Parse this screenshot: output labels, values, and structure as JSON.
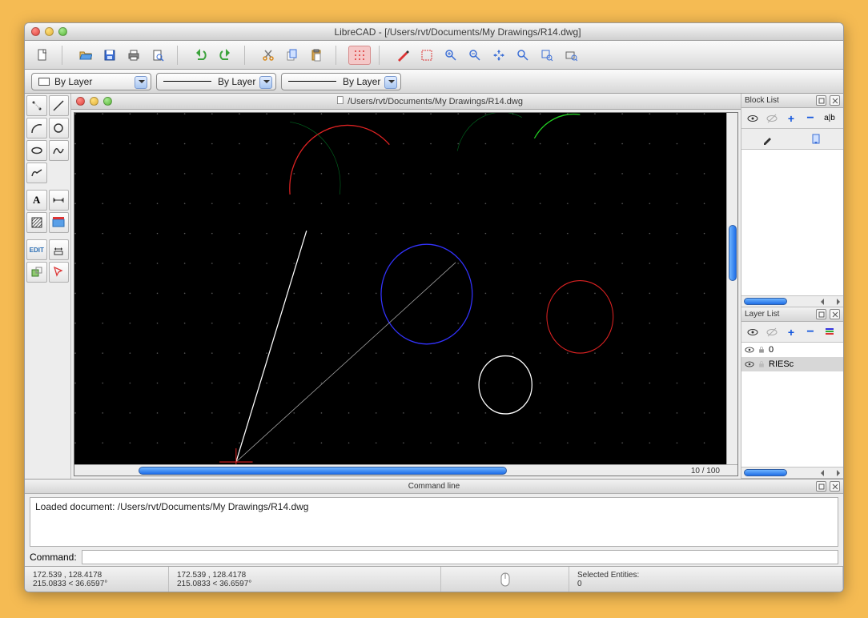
{
  "window": {
    "title": "LibreCAD - [/Users/rvt/Documents/My Drawings/R14.dwg]"
  },
  "propbar": {
    "layer_color": "By Layer",
    "layer_width": "By Layer",
    "layer_linetype": "By Layer"
  },
  "document": {
    "title": "/Users/rvt/Documents/My Drawings/R14.dwg"
  },
  "canvas": {
    "zoom_text": "10 / 100"
  },
  "panels": {
    "block_list": {
      "title": "Block List"
    },
    "layer_list": {
      "title": "Layer List",
      "layers": [
        {
          "name": "0",
          "selected": false
        },
        {
          "name": "RIESc",
          "selected": true
        }
      ]
    }
  },
  "command": {
    "title": "Command line",
    "log": "Loaded document: /Users/rvt/Documents/My Drawings/R14.dwg",
    "prompt": "Command:"
  },
  "status": {
    "coords1": "172.539 , 128.4178",
    "polar1": "215.0833 < 36.6597°",
    "coords2": "172.539 , 128.4178",
    "polar2": "215.0833 < 36.6597°",
    "selected_label": "Selected Entities:",
    "selected_count": "0"
  }
}
